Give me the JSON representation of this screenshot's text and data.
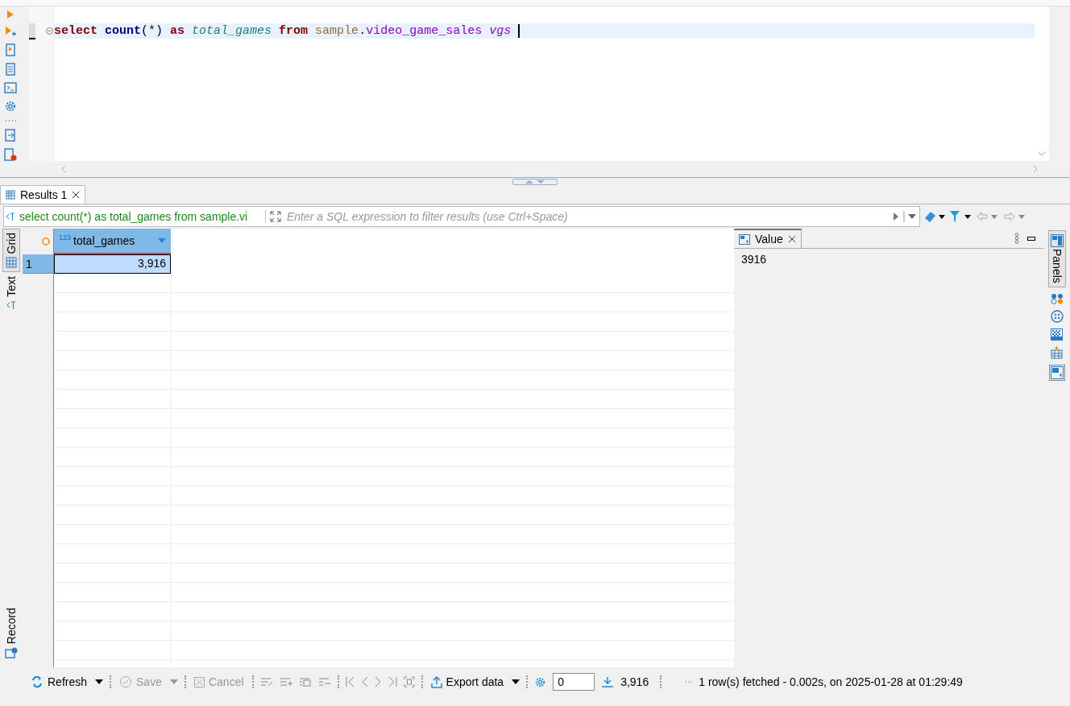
{
  "editor": {
    "tokens": [
      {
        "text": "select",
        "kind": "keyword"
      },
      {
        "text": " count",
        "kind": "function"
      },
      {
        "text": "(*)",
        "kind": "punct"
      },
      {
        "text": " as",
        "kind": "keyword"
      },
      {
        "text": " total_games",
        "kind": "alias"
      },
      {
        "text": " from",
        "kind": "keyword"
      },
      {
        "text": " sample",
        "kind": "schema"
      },
      {
        "text": ".",
        "kind": "punct"
      },
      {
        "text": "video_game_sales",
        "kind": "table"
      },
      {
        "text": " vgs",
        "kind": "alias2"
      }
    ],
    "line_highlighted": true
  },
  "results_tabs": [
    {
      "label": "Results 1",
      "selected": true
    }
  ],
  "filter": {
    "query": "select count(*) as total_games from sample.vi",
    "placeholder": "Enter a SQL expression to filter results (use Ctrl+Space)"
  },
  "view_tabs": [
    {
      "label": "Grid",
      "kind": "grid",
      "selected": true
    },
    {
      "label": "Text",
      "kind": "text",
      "selected": false
    },
    {
      "label": "Record",
      "kind": "record",
      "selected": false
    }
  ],
  "grid": {
    "columns": [
      {
        "type_badge": "123",
        "name": "total_games"
      }
    ],
    "rows": [
      {
        "number": "1",
        "cells": [
          "3,916"
        ],
        "selected": true
      }
    ]
  },
  "value_panel": {
    "title": "Value",
    "value": "3916"
  },
  "side_panel": {
    "label": "Panels",
    "selected": true
  },
  "toolbar": {
    "buttons": [
      {
        "label": "Refresh",
        "kind": "refresh",
        "disabled": false
      },
      {
        "label": "Save",
        "kind": "save",
        "disabled": true
      },
      {
        "label": "Cancel",
        "kind": "cancel",
        "disabled": true
      }
    ],
    "export": {
      "label": "Export data",
      "disabled": false
    },
    "fetch_size": "0",
    "row_count": "3,916",
    "status": "1 row(s) fetched - 0.002s, on 2025-01-28 at 01:29:49"
  }
}
